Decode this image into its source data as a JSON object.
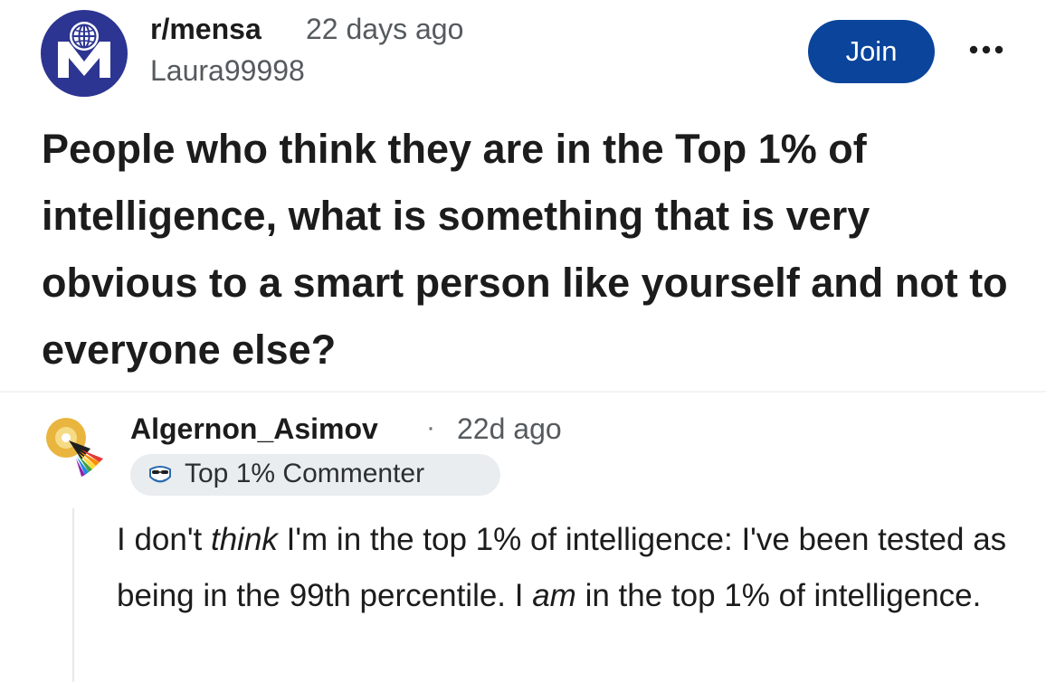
{
  "post": {
    "subreddit": "r/mensa",
    "time_ago": "22 days ago",
    "author": "Laura99998",
    "join_label": "Join",
    "more_icon": "more-horizontal-icon",
    "title": "People who think they are in the Top 1% of intelligence, what is something that is very obvious to a smart person like yourself and not to everyone else?"
  },
  "comment": {
    "author": "Algernon_Asimov",
    "separator": "·",
    "time_ago": "22d ago",
    "flair": "Top 1% Commenter",
    "flair_icon": "top-commenter-badge-icon",
    "body": {
      "p1": "I don't ",
      "i1": "think",
      "p2": " I'm in the top 1% of intelligence: I've been tested as being in the 99th percentile. I ",
      "i2": "am",
      "p3": " in the top 1% of intelligence."
    }
  },
  "colors": {
    "join_bg": "#0A449B",
    "mensa_navy": "#2C3591",
    "text": "#1C1C1C",
    "meta": "#555A5E",
    "flair_bg": "#EAEDEF"
  }
}
